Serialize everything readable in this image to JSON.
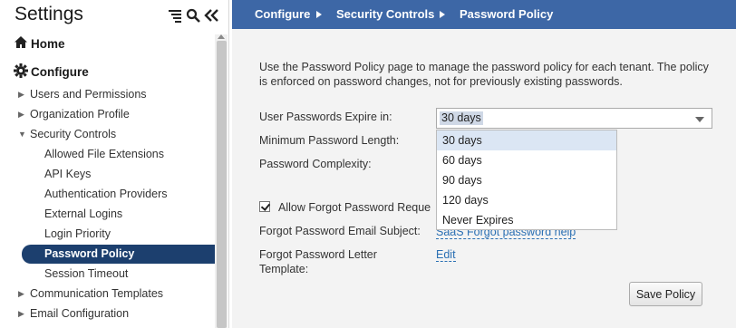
{
  "sidebar": {
    "title": "Settings",
    "tools": [
      "tree-list-icon",
      "search-icon",
      "collapse-icon"
    ],
    "home_label": "Home",
    "configure_label": "Configure",
    "items": [
      {
        "label": "Users and Permissions",
        "expanded": false
      },
      {
        "label": "Organization Profile",
        "expanded": false
      },
      {
        "label": "Security Controls",
        "expanded": true
      }
    ],
    "security_children": [
      "Allowed File Extensions",
      "API Keys",
      "Authentication Providers",
      "External Logins",
      "Login Priority",
      "Password Policy",
      "Session Timeout"
    ],
    "active_item": "Password Policy",
    "bottom_items": [
      {
        "label": "Communication Templates",
        "expanded": false
      },
      {
        "label": "Email Configuration",
        "expanded": false
      }
    ]
  },
  "breadcrumb": [
    "Configure",
    "Security Controls",
    "Password Policy"
  ],
  "page": {
    "description": "Use the Password Policy page to manage the password policy for each tenant. The policy is enforced on password changes, not for previously existing passwords.",
    "expire_label": "User Passwords Expire in:",
    "expire_value": "30 days",
    "expire_options": [
      "30 days",
      "60 days",
      "90 days",
      "120 days",
      "Never Expires"
    ],
    "min_length_label": "Minimum Password Length:",
    "complexity_label": "Password Complexity:",
    "forgot_label": "Allow Forgot Password Reque",
    "forgot_checked": true,
    "email_subject_label": "Forgot Password Email Subject:",
    "email_subject_value": "SaaS Forgot password help",
    "letter_label_line1": "Forgot Password Letter",
    "letter_label_line2": "Template:",
    "edit_link": "Edit",
    "save_button": "Save Policy"
  },
  "colors": {
    "topbar": "#3d67a6",
    "active_nav": "#1c3f6e",
    "link": "#2a6fb3"
  }
}
